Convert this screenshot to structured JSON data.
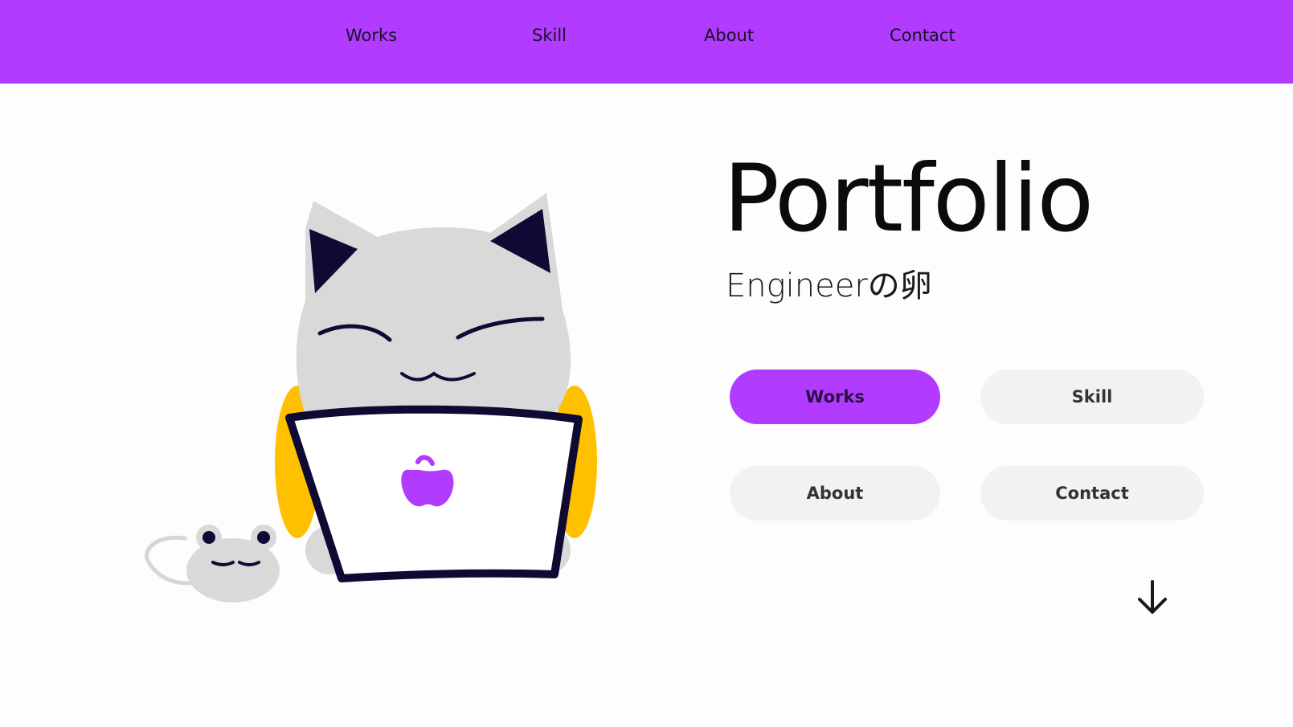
{
  "nav": {
    "items": [
      {
        "label": "Works"
      },
      {
        "label": "Skill"
      },
      {
        "label": "About"
      },
      {
        "label": "Contact"
      }
    ]
  },
  "hero": {
    "title": "Portfolio",
    "subtitle": "Engineerの卵",
    "buttons": [
      {
        "label": "Works"
      },
      {
        "label": "Skill"
      },
      {
        "label": "About"
      },
      {
        "label": "Contact"
      }
    ]
  },
  "icons": {
    "scroll": "arrow-down-icon",
    "illustration": "cat-with-laptop-illustration",
    "laptop_logo": "apple-icon",
    "mouse": "mouse-illustration"
  },
  "colors": {
    "accent": "#b13bff",
    "background": "#fdfdfd",
    "button_bg": "#f2f2f2"
  }
}
